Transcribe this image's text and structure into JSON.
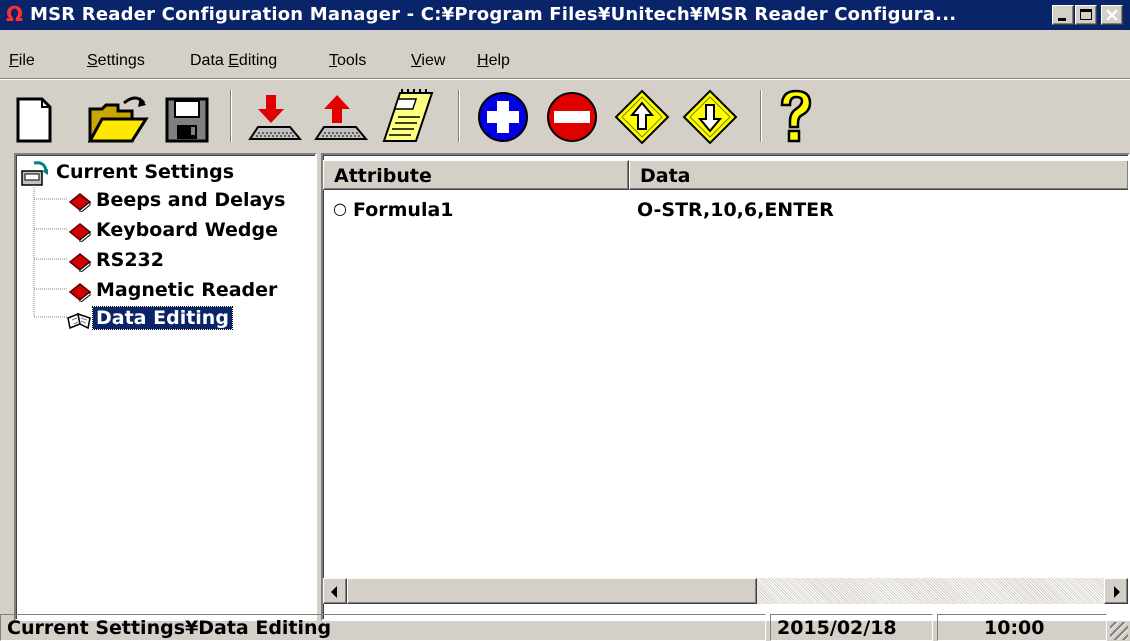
{
  "window": {
    "app_icon": "Ω",
    "title": "MSR Reader Configuration Manager - C:¥Program Files¥Unitech¥MSR Reader Configura...",
    "controls": {
      "minimize": "_",
      "maximize": "□",
      "close": "×"
    }
  },
  "menu": [
    {
      "pre": "",
      "key": "F",
      "post": "ile"
    },
    {
      "pre": "",
      "key": "S",
      "post": "ettings"
    },
    {
      "pre": "Data ",
      "key": "E",
      "post": "diting"
    },
    {
      "pre": "",
      "key": "T",
      "post": "ools"
    },
    {
      "pre": "",
      "key": "V",
      "post": "iew"
    },
    {
      "pre": "",
      "key": "H",
      "post": "elp"
    }
  ],
  "toolbar": {
    "buttons": [
      "new-file-icon",
      "open-folder-icon",
      "save-disk-icon",
      "download-to-reader-icon",
      "upload-from-reader-icon",
      "notepad-edit-icon",
      "add-plus-icon",
      "remove-minus-icon",
      "move-up-icon",
      "move-down-icon",
      "help-question-icon"
    ]
  },
  "tree": {
    "root": "Current Settings",
    "items": [
      {
        "label": "Beeps and Delays",
        "icon": "red-book-icon"
      },
      {
        "label": "Keyboard Wedge",
        "icon": "red-book-icon"
      },
      {
        "label": "RS232",
        "icon": "red-book-icon"
      },
      {
        "label": "Magnetic Reader",
        "icon": "red-book-icon"
      },
      {
        "label": "Data Editing",
        "icon": "open-book-icon",
        "selected": true
      }
    ]
  },
  "list": {
    "columns": [
      "Attribute",
      "Data"
    ],
    "rows": [
      {
        "attribute": "Formula1",
        "data": "O-STR,10,6,ENTER",
        "icon": "○"
      }
    ]
  },
  "statusbar": {
    "path": "Current Settings¥Data Editing",
    "date": "2015/02/18",
    "time": "10:00"
  },
  "colors": {
    "titlebar": "#0a246a",
    "face": "#d4d0c8",
    "selection": "#0a246a"
  }
}
